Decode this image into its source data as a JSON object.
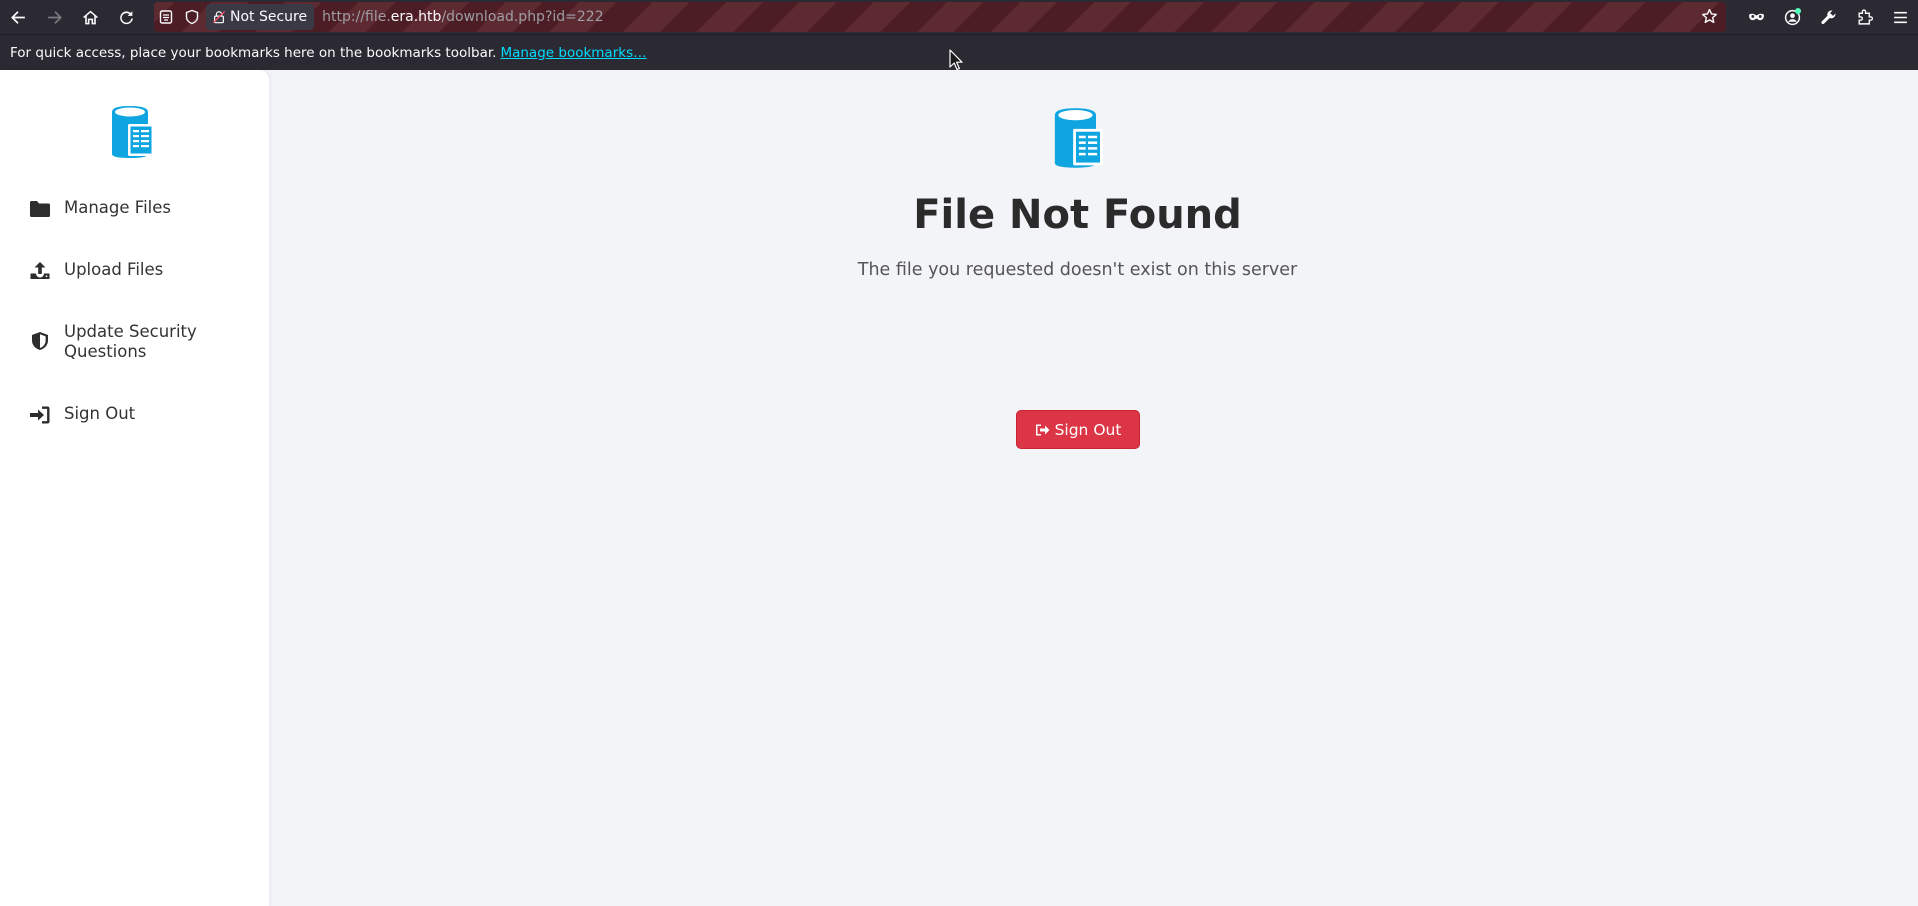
{
  "browser": {
    "nav": {
      "back_icon": "arrow-left-icon",
      "forward_icon": "arrow-right-icon",
      "home_icon": "home-icon",
      "reload_icon": "reload-icon"
    },
    "urlbar": {
      "security_label": "Not Secure",
      "url_prefix": "http://file.",
      "url_host": "era.htb",
      "url_path": "/download.php?id=222"
    },
    "bookmarks_bar": {
      "message": "For quick access, place your bookmarks here on the bookmarks toolbar.",
      "manage_link": "Manage bookmarks…"
    }
  },
  "sidebar": {
    "items": [
      {
        "label": "Manage Files",
        "icon": "folder-icon"
      },
      {
        "label": "Upload Files",
        "icon": "upload-icon"
      },
      {
        "label": "Update Security Questions",
        "icon": "shield-icon"
      },
      {
        "label": "Sign Out",
        "icon": "sign-in-icon"
      }
    ]
  },
  "main": {
    "title": "File Not Found",
    "message": "The file you requested doesn't exist on this server",
    "signout_label": "Sign Out"
  },
  "colors": {
    "accent": "#0ea5e0",
    "danger": "#dc3545",
    "page_bg": "#f3f4f8",
    "chrome_bg": "#2b2a33"
  }
}
